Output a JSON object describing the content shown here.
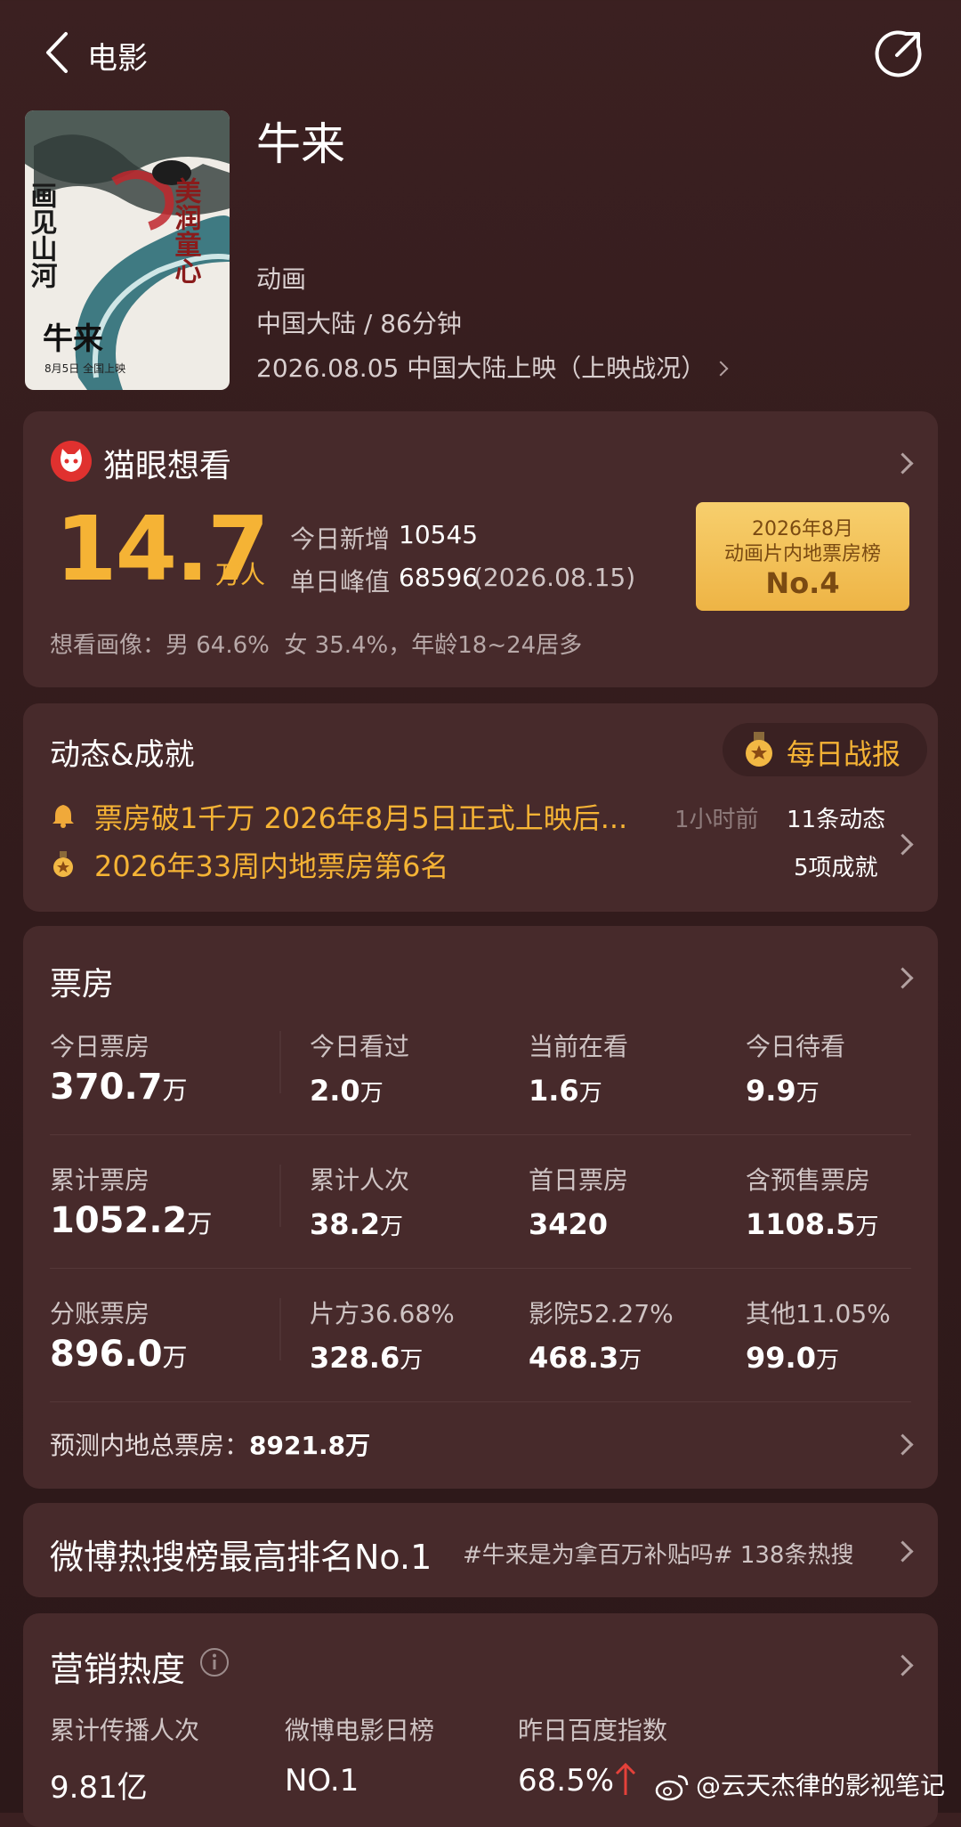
{
  "header": {
    "back_label": "电影"
  },
  "movie": {
    "title": "牛来",
    "genre": "动画",
    "region_duration": "中国大陆 / 86分钟",
    "release": "2026.08.05 中国大陆上映（上映战况）",
    "poster": {
      "left_text": "画见山河",
      "right_text": "美润童心",
      "bottom_title": "牛来",
      "bottom_sub": "8月5日 全国上映"
    }
  },
  "want": {
    "brand": "猫眼想看",
    "count": "14.7",
    "unit": "万人",
    "today_label": "今日新增",
    "today_value": "10545",
    "peak_label": "单日峰值",
    "peak_value": "68596",
    "peak_date": "(2026.08.15)",
    "badge_line1": "2026年8月",
    "badge_line2": "动画片内地票房榜",
    "badge_rank": "No.4",
    "portrait": "想看画像：男 64.6%  女 35.4%，年龄18~24居多"
  },
  "dynamics": {
    "title": "动态&成就",
    "daily_btn": "每日战报",
    "item1": "票房破1千万 2026年8月5日正式上映后...",
    "item1_time": "1小时前",
    "item1_count": "11条动态",
    "item2": "2026年33周内地票房第6名",
    "item2_count": "5项成就"
  },
  "boxoffice": {
    "title": "票房",
    "rows": [
      [
        {
          "label": "今日票房",
          "value": "370.7",
          "unit": "万"
        },
        {
          "label": "今日看过",
          "value": "2.0",
          "unit": "万"
        },
        {
          "label": "当前在看",
          "value": "1.6",
          "unit": "万"
        },
        {
          "label": "今日待看",
          "value": "9.9",
          "unit": "万"
        }
      ],
      [
        {
          "label": "累计票房",
          "value": "1052.2",
          "unit": "万"
        },
        {
          "label": "累计人次",
          "value": "38.2",
          "unit": "万"
        },
        {
          "label": "首日票房",
          "value": "3420",
          "unit": ""
        },
        {
          "label": "含预售票房",
          "value": "1108.5",
          "unit": "万"
        }
      ],
      [
        {
          "label": "分账票房",
          "value": "896.0",
          "unit": "万"
        },
        {
          "label": "片方36.68%",
          "value": "328.6",
          "unit": "万"
        },
        {
          "label": "影院52.27%",
          "value": "468.3",
          "unit": "万"
        },
        {
          "label": "其他11.05%",
          "value": "99.0",
          "unit": "万"
        }
      ]
    ],
    "forecast_label": "预测内地总票房：",
    "forecast_value": "8921.8万"
  },
  "weibo": {
    "title": "微博热搜榜最高排名No.1",
    "topic": "#牛来是为拿百万补贴吗# 138条热搜"
  },
  "marketing": {
    "title": "营销热度",
    "items": [
      {
        "label": "累计传播人次",
        "value": "9.81亿"
      },
      {
        "label": "微博电影日榜",
        "value": "NO.1"
      },
      {
        "label": "昨日百度指数",
        "value": "68.5%"
      }
    ]
  },
  "watermark": "@云天杰律的影视笔记",
  "colors": {
    "accent_gold": "#f5b335",
    "badge_bg": "#f4c65e",
    "card_bg": "#472a2b",
    "page_bg": "#341c1d",
    "up_red": "#e5413a"
  }
}
